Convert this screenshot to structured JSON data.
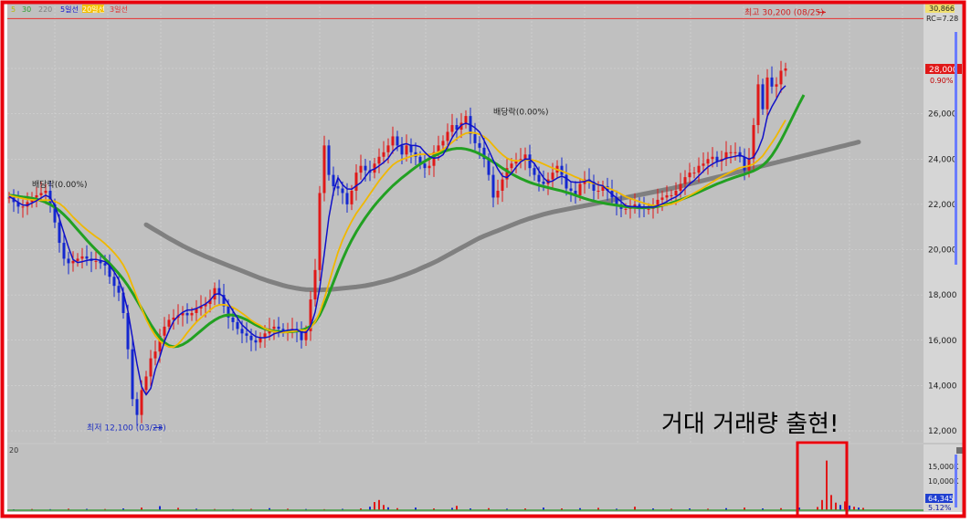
{
  "legend": {
    "items": [
      {
        "label": "5",
        "color": "#b8b800"
      },
      {
        "label": "30",
        "color": "#2e9e2e"
      },
      {
        "label": "220",
        "color": "#7f7f7f"
      },
      {
        "label": "5일선",
        "color": "#1010d0"
      },
      {
        "label": "20일선",
        "color": "#f5c000"
      },
      {
        "label": "3일선",
        "color": "#e03030"
      }
    ]
  },
  "colors": {
    "background": "#c0c0c0",
    "up_candle": "#e01818",
    "down_candle": "#1428d0",
    "ma_short": "#1010c8",
    "ma_mid": "#f0b800",
    "ma_long": "#22a022",
    "ma_220": "#808080",
    "highlight_border": "#e8000c"
  },
  "chart_data": [
    {
      "type": "line",
      "title": "",
      "ylim": [
        11500,
        30900
      ],
      "yticks": [
        "12,000",
        "14,000",
        "16,000",
        "18,000",
        "20,000",
        "22,000",
        "24,000",
        "26,000",
        "28,000"
      ],
      "price_labels": {
        "current": "28,000",
        "current_change": "0.90%",
        "top_value": "30,866",
        "top_marker": "RC=7.28"
      },
      "x": [
        0,
        5,
        10,
        15,
        20,
        25,
        30,
        35,
        40,
        45,
        50,
        55,
        60,
        65,
        70,
        75,
        80,
        85,
        90,
        95,
        100,
        105,
        110,
        115,
        120,
        125,
        130,
        135,
        140,
        145,
        150,
        155,
        160,
        165,
        170,
        175,
        180,
        185,
        190,
        195,
        200,
        205,
        210,
        215,
        220,
        225,
        230,
        235,
        240,
        245,
        250,
        255,
        260,
        265,
        270,
        275,
        280,
        285,
        290,
        295,
        300,
        305,
        310,
        315,
        320,
        325,
        330,
        335,
        340,
        345,
        350,
        355,
        360,
        365,
        370,
        375,
        380,
        385,
        390,
        395,
        400,
        405,
        410,
        415,
        420,
        425,
        430,
        435,
        440,
        445,
        450,
        455,
        460,
        465,
        470,
        475,
        480,
        485,
        490,
        495,
        500,
        505,
        510,
        515,
        520,
        525,
        530,
        535,
        540,
        545,
        550,
        555,
        560,
        565,
        570,
        575,
        580,
        585,
        590,
        595,
        600,
        605,
        610,
        615,
        620,
        625,
        630,
        635,
        640,
        645,
        650,
        655,
        660,
        665,
        670,
        675,
        680,
        685,
        690,
        695,
        700,
        705,
        710,
        715,
        720,
        725,
        730,
        735,
        740,
        745,
        750,
        755,
        760,
        765,
        770,
        775,
        780,
        785,
        790,
        795,
        800,
        805,
        810,
        815,
        820,
        825,
        830,
        835,
        840,
        845,
        850,
        855,
        860,
        865,
        870,
        875,
        880,
        885,
        890,
        895,
        900,
        905,
        910,
        915,
        920,
        925
      ],
      "close": [
        22300,
        22100,
        21900,
        21900,
        22100,
        22300,
        22400,
        22500,
        22600,
        22000,
        21200,
        20300,
        19600,
        19400,
        19500,
        19600,
        19700,
        19600,
        19500,
        19500,
        19400,
        19300,
        18800,
        18400,
        18100,
        17200,
        15600,
        13400,
        12700,
        13800,
        14400,
        15200,
        15500,
        16200,
        16600,
        16900,
        17000,
        17100,
        17200,
        17100,
        17200,
        17400,
        17500,
        17600,
        17800,
        18300,
        18000,
        17500,
        17000,
        16800,
        16500,
        16300,
        16200,
        16000,
        15900,
        16100,
        16300,
        16500,
        16600,
        16500,
        16400,
        16400,
        16500,
        16400,
        16000,
        16400,
        17800,
        19100,
        22500,
        24600,
        23300,
        22800,
        22700,
        22500,
        22000,
        22600,
        23400,
        23700,
        23500,
        23400,
        23800,
        24100,
        24300,
        24600,
        25000,
        24600,
        24200,
        24600,
        24300,
        24100,
        23800,
        23600,
        23700,
        24300,
        24600,
        24800,
        25200,
        25500,
        25300,
        25600,
        25900,
        25100,
        24700,
        24500,
        24000,
        23300,
        22300,
        22600,
        23100,
        23600,
        23800,
        23900,
        24000,
        24200,
        23600,
        23300,
        23000,
        22900,
        23100,
        23400,
        23700,
        23300,
        22700,
        22600,
        22400,
        22900,
        23100,
        23000,
        22600,
        22600,
        22800,
        22600,
        22300,
        22000,
        21800,
        21800,
        21900,
        22000,
        21900,
        21800,
        21800,
        21900,
        22200,
        22300,
        22400,
        22400,
        22600,
        22900,
        23200,
        23400,
        23400,
        23700,
        23800,
        24000,
        24100,
        23900,
        24000,
        24300,
        24300,
        24300,
        24100,
        23500,
        24000,
        25500,
        27300,
        26200,
        27600,
        27200,
        27300,
        27900,
        28000
      ],
      "ma5": [
        22350,
        22230,
        22080,
        21970,
        21960,
        22060,
        22160,
        22280,
        22400,
        22300,
        21940,
        21380,
        20730,
        20100,
        19560,
        19430,
        19470,
        19520,
        19560,
        19570,
        19520,
        19470,
        19300,
        19020,
        18670,
        18100,
        17300,
        16110,
        14950,
        13950,
        13590,
        13870,
        14700,
        15270,
        15940,
        16420,
        16840,
        17070,
        17230,
        17330,
        17340,
        17400,
        17500,
        17600,
        17760,
        18020,
        18060,
        17920,
        17620,
        17290,
        16980,
        16680,
        16490,
        16310,
        16160,
        16110,
        16110,
        16160,
        16280,
        16340,
        16400,
        16440,
        16460,
        16460,
        16360,
        16340,
        16610,
        17240,
        18300,
        19820,
        21420,
        22530,
        23180,
        22870,
        22680,
        22670,
        22820,
        22960,
        23220,
        23490,
        23560,
        23700,
        23850,
        24040,
        24340,
        24530,
        24630,
        24680,
        24600,
        24600,
        24540,
        24300,
        24110,
        24040,
        24060,
        24190,
        24540,
        24940,
        25260,
        25500,
        25580,
        25510,
        25380,
        25190,
        24820,
        24400,
        23950,
        23560,
        23250,
        23180,
        23370,
        23640,
        23880,
        24000,
        23990,
        23800,
        23480,
        23180,
        22980,
        23030,
        23160,
        23250,
        23150,
        23000,
        22970,
        22980,
        23010,
        23080,
        22950,
        22860,
        22820,
        22620,
        22440,
        22290,
        22120,
        21940,
        21900,
        21900,
        21880,
        21880,
        21880,
        21880,
        21940,
        22020,
        22120,
        22240,
        22330,
        22480,
        22700,
        22900,
        23060,
        23260,
        23460,
        23650,
        23780,
        23890,
        23940,
        24040,
        24080,
        24120,
        24170,
        24090,
        24000,
        24080,
        24430,
        24940,
        25880,
        26310,
        26660,
        27040,
        27240
      ],
      "ma20": [
        22400,
        22350,
        22300,
        22260,
        22220,
        22200,
        22180,
        22180,
        22190,
        22180,
        22130,
        22040,
        21880,
        21660,
        21440,
        21240,
        21050,
        20880,
        20720,
        20570,
        20430,
        20260,
        20070,
        19860,
        19620,
        19320,
        18930,
        18410,
        17890,
        17400,
        16920,
        16530,
        16200,
        15970,
        15810,
        15700,
        15700,
        15830,
        16060,
        16330,
        16580,
        16800,
        16990,
        17160,
        17330,
        17490,
        17560,
        17570,
        17530,
        17450,
        17330,
        17190,
        17040,
        16880,
        16750,
        16650,
        16520,
        16440,
        16380,
        16350,
        16340,
        16360,
        16390,
        16420,
        16440,
        16450,
        16550,
        16810,
        17230,
        17820,
        18510,
        19220,
        19880,
        20420,
        20860,
        21250,
        21600,
        21880,
        22160,
        22460,
        22750,
        23040,
        23290,
        23530,
        23740,
        23880,
        23980,
        24050,
        24120,
        24170,
        24210,
        24210,
        24200,
        24240,
        24310,
        24420,
        24570,
        24740,
        24900,
        25040,
        25140,
        25170,
        25150,
        25090,
        24990,
        24830,
        24600,
        24380,
        24190,
        24040,
        23950,
        23920,
        23920,
        23960,
        23970,
        23940,
        23870,
        23780,
        23690,
        23600,
        23530,
        23470,
        23390,
        23300,
        23210,
        23130,
        23040,
        22980,
        22920,
        22870,
        22810,
        22730,
        22650,
        22560,
        22450,
        22340,
        22260,
        22190,
        22120,
        22050,
        21990,
        21960,
        21940,
        21950,
        21980,
        22010,
        22080,
        22170,
        22280,
        22390,
        22500,
        22610,
        22730,
        22860,
        22990,
        23110,
        23220,
        23330,
        23430,
        23530,
        23620,
        23660,
        23700,
        23780,
        23950,
        24140,
        24430,
        24720,
        25030,
        25380,
        25720
      ],
      "ma60": [
        22400,
        22380,
        22350,
        22320,
        22300,
        22270,
        22230,
        22170,
        22090,
        21990,
        21870,
        21720,
        21540,
        21340,
        21110,
        20880,
        20650,
        20420,
        20200,
        19990,
        19790,
        19590,
        19390,
        19170,
        18940,
        18690,
        18410,
        18090,
        17750,
        17400,
        17040,
        16700,
        16390,
        16110,
        15900,
        15760,
        15710,
        15730,
        15810,
        15930,
        16080,
        16250,
        16420,
        16590,
        16750,
        16890,
        17000,
        17080,
        17120,
        17110,
        17060,
        16990,
        16900,
        16790,
        16680,
        16580,
        16500,
        16440,
        16400,
        16380,
        16370,
        16370,
        16380,
        16400,
        16440,
        16510,
        16620,
        16810,
        17120,
        17540,
        18040,
        18560,
        19080,
        19570,
        20020,
        20420,
        20780,
        21110,
        21410,
        21690,
        21950,
        22190,
        22410,
        22620,
        22820,
        23000,
        23170,
        23330,
        23490,
        23640,
        23780,
        23900,
        24020,
        24130,
        24230,
        24320,
        24390,
        24440,
        24470,
        24470,
        24440,
        24390,
        24320,
        24230,
        24120,
        24000,
        23870,
        23740,
        23600,
        23470,
        23350,
        23240,
        23140,
        23050,
        22970,
        22900,
        22840,
        22790,
        22740,
        22690,
        22640,
        22590,
        22530,
        22470,
        22400,
        22330,
        22260,
        22200,
        22150,
        22100,
        22060,
        22020,
        21990,
        21960,
        21930,
        21900,
        21880,
        21860,
        21850,
        21850,
        21860,
        21880,
        21910,
        21950,
        22000,
        22060,
        22130,
        22200,
        22280,
        22360,
        22450,
        22540,
        22630,
        22720,
        22810,
        22900,
        22980,
        23060,
        23130,
        23200,
        23270,
        23330,
        23400,
        23480,
        23580,
        23720,
        23910,
        24160,
        24470,
        24830,
        25220,
        25630,
        26040,
        26450,
        26830
      ],
      "ma220": [
        null,
        null,
        null,
        null,
        null,
        null,
        null,
        null,
        null,
        null,
        null,
        null,
        null,
        null,
        null,
        null,
        null,
        null,
        null,
        null,
        null,
        null,
        null,
        null,
        null,
        null,
        null,
        null,
        null,
        null,
        21100,
        20980,
        20860,
        20740,
        20620,
        20500,
        20390,
        20280,
        20170,
        20070,
        19970,
        19880,
        19790,
        19700,
        19620,
        19540,
        19460,
        19380,
        19300,
        19220,
        19140,
        19060,
        18980,
        18900,
        18820,
        18740,
        18670,
        18600,
        18540,
        18480,
        18420,
        18370,
        18330,
        18290,
        18260,
        18240,
        18230,
        18220,
        18220,
        18230,
        18240,
        18250,
        18270,
        18290,
        18310,
        18330,
        18350,
        18380,
        18410,
        18450,
        18490,
        18540,
        18590,
        18640,
        18700,
        18770,
        18840,
        18910,
        18990,
        19070,
        19160,
        19250,
        19340,
        19430,
        19530,
        19640,
        19750,
        19860,
        19970,
        20080,
        20190,
        20300,
        20410,
        20510,
        20600,
        20680,
        20760,
        20840,
        20920,
        21000,
        21080,
        21160,
        21240,
        21310,
        21380,
        21440,
        21500,
        21560,
        21610,
        21660,
        21700,
        21740,
        21780,
        21820,
        21860,
        21900,
        21940,
        21980,
        22020,
        22060,
        22100,
        22140,
        22180,
        22220,
        22260,
        22300,
        22340,
        22380,
        22420,
        22460,
        22500,
        22540,
        22580,
        22620,
        22660,
        22700,
        22750,
        22800,
        22850,
        22900,
        22950,
        23000,
        23050,
        23100,
        23150,
        23200,
        23250,
        23300,
        23350,
        23400,
        23450,
        23500,
        23550,
        23600,
        23650,
        23700,
        23750,
        23800,
        23850,
        23900,
        23950,
        24000,
        24050,
        24100,
        24150,
        24200,
        24250,
        24300,
        24350,
        24400,
        24450,
        24500,
        24550,
        24600,
        24650,
        24700,
        24750,
        24800,
        24850,
        24900,
        24950,
        25000,
        25050,
        25100,
        25150,
        25200,
        25250,
        25300,
        25350,
        25400,
        25450,
        25500,
        25550,
        25600,
        25650
      ],
      "annotations": [
        {
          "text": "배당락(0.00%)",
          "x": 25,
          "price": 22600
        },
        {
          "text": "배당락(0.00%)",
          "x": 530,
          "price": 25800
        },
        {
          "text": "최고 30,200 (08/25)",
          "x": 895,
          "price": 30200
        },
        {
          "text": "최저 12,100 (03/23)",
          "x": 170,
          "price": 12100
        }
      ],
      "callout_text": "거대 거래량 출현!"
    },
    {
      "type": "bar",
      "title": "",
      "ylabel": "",
      "corner_label": "20",
      "yticks": [
        "15,000K",
        "10,000K"
      ],
      "volume_labels": {
        "current": "64,345",
        "percent": "5.12%"
      },
      "ylim": [
        0,
        20000
      ],
      "x": [
        5,
        25,
        45,
        65,
        85,
        105,
        125,
        145,
        165,
        185,
        205,
        225,
        245,
        265,
        285,
        305,
        325,
        345,
        365,
        385,
        395,
        400,
        405,
        410,
        415,
        425,
        445,
        465,
        485,
        490,
        505,
        525,
        545,
        565,
        585,
        605,
        625,
        645,
        665,
        685,
        705,
        725,
        745,
        765,
        785,
        805,
        825,
        845,
        865,
        885,
        890,
        895,
        900,
        905,
        910,
        915,
        920,
        925,
        930,
        935
      ],
      "values": [
        300,
        400,
        350,
        500,
        450,
        400,
        600,
        900,
        1400,
        800,
        500,
        400,
        350,
        450,
        700,
        500,
        400,
        350,
        450,
        600,
        1200,
        2800,
        3500,
        1800,
        1000,
        700,
        900,
        600,
        800,
        1500,
        600,
        700,
        500,
        600,
        900,
        600,
        700,
        800,
        500,
        1200,
        600,
        500,
        600,
        500,
        700,
        900,
        600,
        700,
        900,
        1100,
        3500,
        17000,
        5200,
        2600,
        1800,
        3000,
        1600,
        1200,
        900,
        800
      ]
    }
  ]
}
